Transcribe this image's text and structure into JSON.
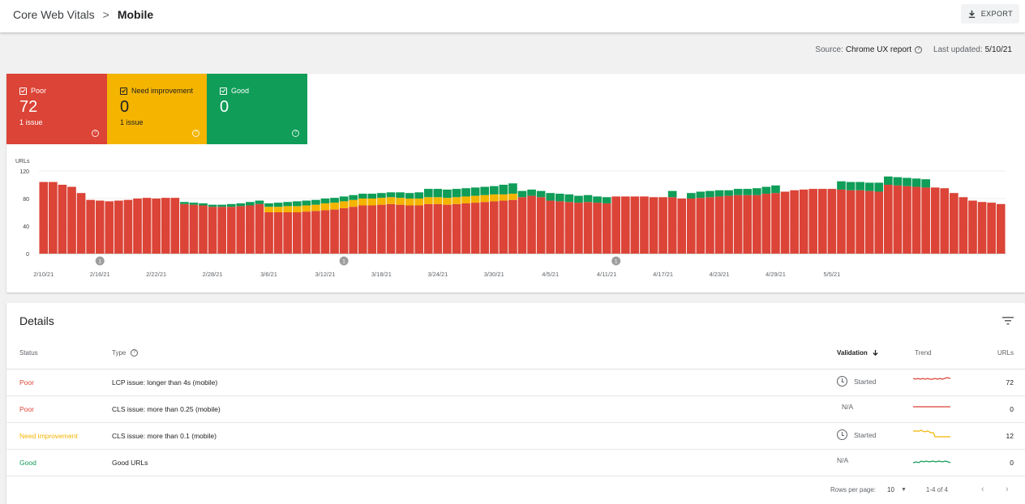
{
  "header": {
    "breadcrumb_parent": "Core Web Vitals",
    "breadcrumb_sep": ">",
    "breadcrumb_current": "Mobile",
    "export_label": "EXPORT"
  },
  "source_bar": {
    "source_label": "Source:",
    "source_value": "Chrome UX report",
    "updated_label": "Last updated:",
    "updated_value": "5/10/21"
  },
  "tiles": [
    {
      "label": "Poor",
      "count": "72",
      "issues": "1 issue"
    },
    {
      "label": "Need improvement",
      "count": "0",
      "issues": "1 issue"
    },
    {
      "label": "Good",
      "count": "0",
      "issues": ""
    }
  ],
  "colors": {
    "poor": "#db4437",
    "need_improvement": "#f4b400",
    "good": "#0f9d58"
  },
  "chart_data": {
    "type": "bar",
    "stacked": true,
    "ylabel": "URLs",
    "ylim": [
      0,
      120
    ],
    "yticks": [
      0,
      40,
      80,
      120
    ],
    "grid": true,
    "x_tick_labels": [
      "2/10/21",
      "2/16/21",
      "2/22/21",
      "2/28/21",
      "3/6/21",
      "3/12/21",
      "3/18/21",
      "3/24/21",
      "3/30/21",
      "4/5/21",
      "4/11/21",
      "4/17/21",
      "4/23/21",
      "4/29/21",
      "5/5/21"
    ],
    "annotation_markers": [
      "1",
      "1",
      "1"
    ],
    "series": [
      {
        "name": "Poor",
        "color": "#db4437",
        "values": [
          104,
          104,
          100,
          97,
          88,
          78,
          77,
          76,
          77,
          78,
          80,
          81,
          80,
          81,
          81,
          72,
          71,
          70,
          68,
          68,
          68,
          69,
          70,
          72,
          60,
          60,
          60,
          60,
          61,
          62,
          63,
          64,
          66,
          68,
          70,
          70,
          71,
          72,
          71,
          70,
          70,
          72,
          72,
          71,
          72,
          73,
          74,
          75,
          76,
          77,
          78,
          82,
          84,
          82,
          77,
          76,
          75,
          74,
          75,
          74,
          73,
          83,
          83,
          83,
          83,
          82,
          82,
          82,
          80,
          80,
          81,
          82,
          83,
          84,
          85,
          85,
          85,
          87,
          88,
          90,
          92,
          93,
          94,
          94,
          94,
          93,
          92,
          92,
          91,
          90,
          100,
          99,
          98,
          97,
          96,
          96,
          95,
          88,
          82,
          77,
          75,
          74,
          72
        ]
      },
      {
        "name": "Need improvement",
        "color": "#f4b400",
        "values": [
          0,
          0,
          0,
          0,
          0,
          0,
          0,
          0,
          0,
          0,
          0,
          0,
          0,
          0,
          0,
          0,
          0,
          0,
          0,
          0,
          0,
          0,
          0,
          0,
          8,
          8,
          9,
          9,
          9,
          9,
          10,
          10,
          10,
          10,
          10,
          10,
          10,
          10,
          10,
          10,
          10,
          10,
          10,
          10,
          10,
          10,
          10,
          10,
          10,
          9,
          9,
          0,
          0,
          0,
          0,
          0,
          0,
          0,
          0,
          0,
          0,
          0,
          0,
          0,
          0,
          0,
          0,
          0,
          0,
          0,
          0,
          0,
          0,
          0,
          0,
          0,
          0,
          0,
          0,
          0,
          0,
          0,
          0,
          0,
          0,
          0,
          0,
          0,
          0,
          0,
          0,
          0,
          0,
          0,
          0,
          0,
          0,
          0,
          0,
          0,
          0,
          0,
          0
        ]
      },
      {
        "name": "Good",
        "color": "#0f9d58",
        "values": [
          0,
          0,
          0,
          0,
          0,
          0,
          0,
          0,
          0,
          0,
          0,
          0,
          0,
          0,
          0,
          3,
          3,
          3,
          3,
          3,
          4,
          4,
          5,
          5,
          5,
          6,
          6,
          7,
          7,
          7,
          7,
          7,
          7,
          7,
          7,
          7,
          7,
          7,
          8,
          8,
          9,
          12,
          12,
          12,
          12,
          12,
          12,
          12,
          12,
          14,
          15,
          9,
          9,
          9,
          11,
          11,
          11,
          10,
          10,
          9,
          9,
          0,
          0,
          0,
          0,
          0,
          0,
          9,
          0,
          8,
          9,
          9,
          9,
          8,
          9,
          9,
          10,
          10,
          11,
          0,
          0,
          0,
          0,
          0,
          0,
          12,
          12,
          12,
          12,
          13,
          12,
          12,
          12,
          12,
          12,
          0,
          0,
          0,
          0,
          0,
          0,
          0,
          0
        ]
      }
    ]
  },
  "details": {
    "title": "Details",
    "columns": {
      "status": "Status",
      "type": "Type",
      "validation": "Validation",
      "trend": "Trend",
      "urls": "URLs"
    },
    "rows": [
      {
        "status": "Poor",
        "status_color": "#db4437",
        "type": "LCP issue: longer than 4s (mobile)",
        "validation": "Started",
        "trend_color": "#db4437",
        "urls": "72"
      },
      {
        "status": "Poor",
        "status_color": "#db4437",
        "type": "CLS issue: more than 0.25 (mobile)",
        "validation": "N/A",
        "trend_color": "#db4437",
        "urls": "0"
      },
      {
        "status": "Need improvement",
        "status_color": "#f4b400",
        "type": "CLS issue: more than 0.1 (mobile)",
        "validation": "Started",
        "trend_color": "#f4b400",
        "urls": "12"
      },
      {
        "status": "Good",
        "status_color": "#0f9d58",
        "type": "Good URLs",
        "validation": "N/A",
        "trend_color": "#0f9d58",
        "urls": "0"
      }
    ],
    "footer": {
      "rows_per_page_label": "Rows per page:",
      "rows_per_page_value": "10",
      "range": "1-4 of 4"
    }
  }
}
